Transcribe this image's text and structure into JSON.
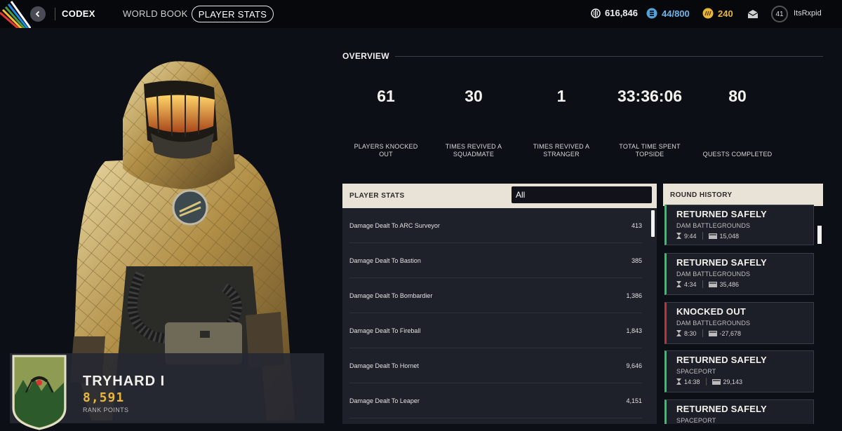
{
  "nav": {
    "codex": "CODEX",
    "world_book": "WORLD BOOK",
    "player_stats": "PLAYER STATS"
  },
  "currencies": {
    "coins": "616,846",
    "storage": "44/800",
    "tokens": "240"
  },
  "user": {
    "level": "41",
    "name": "ItsRxpid"
  },
  "rank": {
    "title": "TRYHARD I",
    "points": "8,591",
    "points_label": "RANK POINTS"
  },
  "overview": {
    "title": "OVERVIEW",
    "stats": [
      {
        "value": "61",
        "label_line1": "PLAYERS KNOCKED",
        "label_line2": "OUT"
      },
      {
        "value": "30",
        "label_line1": "TIMES REVIVED A",
        "label_line2": "SQUADMATE"
      },
      {
        "value": "1",
        "label_line1": "TIMES REVIVED A",
        "label_line2": "STRANGER"
      },
      {
        "value": "33:36:06",
        "label_line1": "TOTAL TIME SPENT",
        "label_line2": "TOPSIDE"
      },
      {
        "value": "80",
        "label_line1": "",
        "label_line2": "QUESTS COMPLETED"
      }
    ]
  },
  "player_stats": {
    "title": "PLAYER STATS",
    "filter": "All",
    "rows": [
      {
        "name": "Damage Dealt To ARC Surveyor",
        "value": "413"
      },
      {
        "name": "Damage Dealt To Bastion",
        "value": "385"
      },
      {
        "name": "Damage Dealt To Bombardier",
        "value": "1,386"
      },
      {
        "name": "Damage Dealt To Fireball",
        "value": "1,843"
      },
      {
        "name": "Damage Dealt To Hornet",
        "value": "9,646"
      },
      {
        "name": "Damage Dealt To Leaper",
        "value": "4,151"
      }
    ]
  },
  "round_history": {
    "title": "ROUND HISTORY",
    "rounds": [
      {
        "result": "RETURNED SAFELY",
        "map": "DAM BATTLEGROUNDS",
        "time": "9:44",
        "loot": "15,048"
      },
      {
        "result": "RETURNED SAFELY",
        "map": "DAM BATTLEGROUNDS",
        "time": "4:34",
        "loot": "35,486"
      },
      {
        "result": "KNOCKED OUT",
        "map": "DAM BATTLEGROUNDS",
        "time": "8:30",
        "loot": "-27,678"
      },
      {
        "result": "RETURNED SAFELY",
        "map": "SPACEPORT",
        "time": "14:38",
        "loot": "29,143"
      },
      {
        "result": "RETURNED SAFELY",
        "map": "SPACEPORT",
        "time": "",
        "loot": ""
      }
    ]
  },
  "colors": {
    "accent_gold": "#e7b63a",
    "success_green": "#2fc46b",
    "danger_red": "#c0323b",
    "panel_header": "#e9e3d7"
  }
}
